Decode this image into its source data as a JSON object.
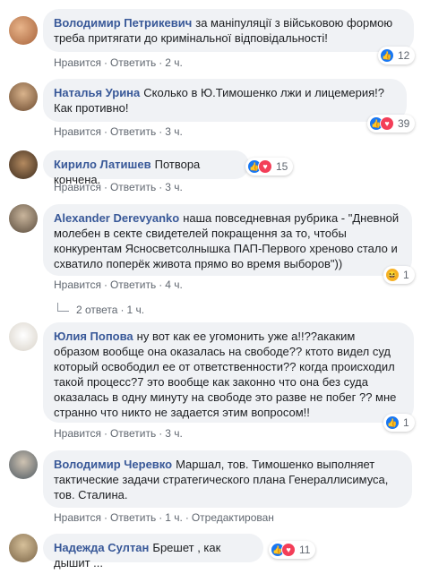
{
  "labels": {
    "like": "Нравится",
    "reply": "Ответить",
    "sep": "·"
  },
  "comments": [
    {
      "author": "Володимир Петрикевич",
      "text": "за маніпуляції з військовою формою треба притягати до кримінальної відповідальності!",
      "time": "2 ч.",
      "reactions_count": "12",
      "reactions": [
        "like-icon"
      ]
    },
    {
      "author": "Наталья Урина",
      "text": "Сколько в Ю.Тимошенко лжи и лицемерия!? Как противно!",
      "time": "3 ч.",
      "reactions_count": "39",
      "reactions": [
        "like-icon",
        "love-icon"
      ]
    },
    {
      "author": "Кирило Латишев",
      "text": "Потвора кончена.",
      "time": "3 ч.",
      "reactions_count": "15",
      "reactions": [
        "like-icon",
        "love-icon"
      ]
    },
    {
      "author": "Alexander Derevyanko",
      "text": "наша повседневная рубрика - \"Дневной молебен в секте свидетелей покращення за то, чтобы конкурентам Ясносветсолнышка ПАП-Первого хреново стало и схватило поперёк живота прямо во время выборов\"))",
      "time": "4 ч.",
      "reactions_count": "1",
      "reactions": [
        "haha-icon"
      ],
      "replies": "2 ответа",
      "replies_time": "1 ч."
    },
    {
      "author": "Юлия Попова",
      "text": "ну вот как ее угомонить уже а!!??акаким образом вообще она оказалась на свободе?? ктото видел суд который освободил ее от ответственности?? когда происходил такой процесс?7 это вообще как законно что она без суда оказалась в одну минуту на свободе это разве не побег ?? мне странно что никто не задается этим вопросом!!",
      "time": "3 ч.",
      "reactions_count": "1",
      "reactions": [
        "like-icon"
      ]
    },
    {
      "author": "Володимир Черевко",
      "text": "Маршал, тов. Тимошенко выполняет тактические задачи стратегического плана Генераллисимуса, тов. Сталина.",
      "time": "1 ч.",
      "edited": "Отредактирован"
    },
    {
      "author": "Надежда Султан",
      "text": "Брешет , как дышит ...",
      "reactions_count": "11",
      "reactions": [
        "like-icon",
        "love-icon"
      ]
    }
  ],
  "colors": {
    "author": "#385898",
    "bubble": "#f0f2f5",
    "like": "#1877f2",
    "love": "#f33e58"
  }
}
